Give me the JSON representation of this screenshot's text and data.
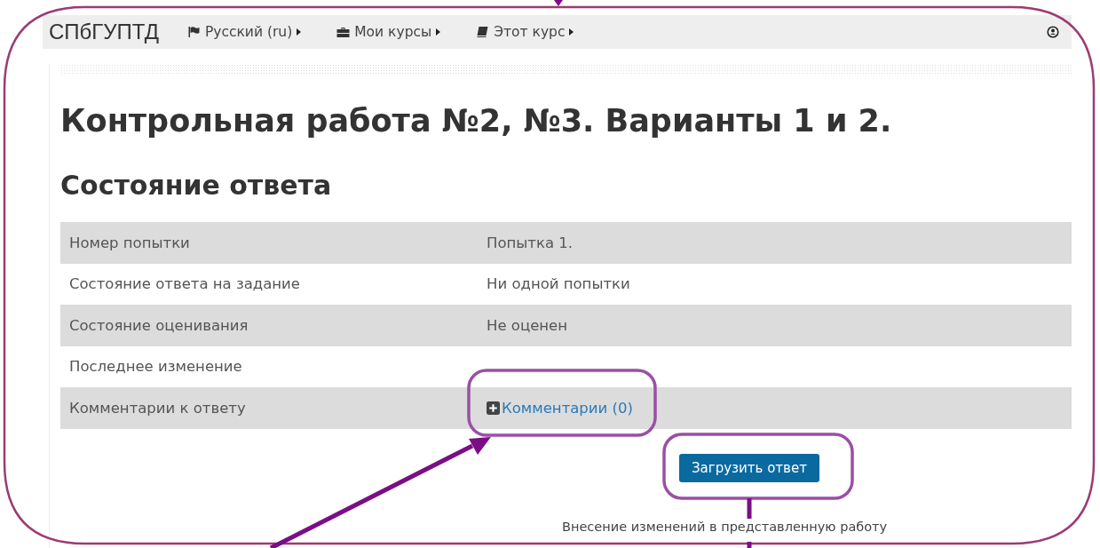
{
  "navbar": {
    "brand": "СПбГУПТД",
    "menus": [
      {
        "label": "Русский (ru)"
      },
      {
        "label": "Мои курсы"
      },
      {
        "label": "Этот курс"
      }
    ]
  },
  "title": "Контрольная работа №2, №3. Варианты 1 и 2.",
  "section_heading": "Состояние ответа",
  "status_table": {
    "rows": [
      {
        "label": "Номер попытки",
        "kind": "text",
        "value": "Попытка 1."
      },
      {
        "label": "Состояние ответа на задание",
        "kind": "text",
        "value": "Ни одной попытки"
      },
      {
        "label": "Состояние оценивания",
        "kind": "text",
        "value": "Не оценен"
      },
      {
        "label": "Последнее изменение",
        "kind": "empty"
      },
      {
        "label": "Комментарии к ответу",
        "kind": "link",
        "value": "Комментарии (0)"
      }
    ]
  },
  "upload_button": "Загрузить ответ",
  "note": "Внесение изменений в представленную работу"
}
